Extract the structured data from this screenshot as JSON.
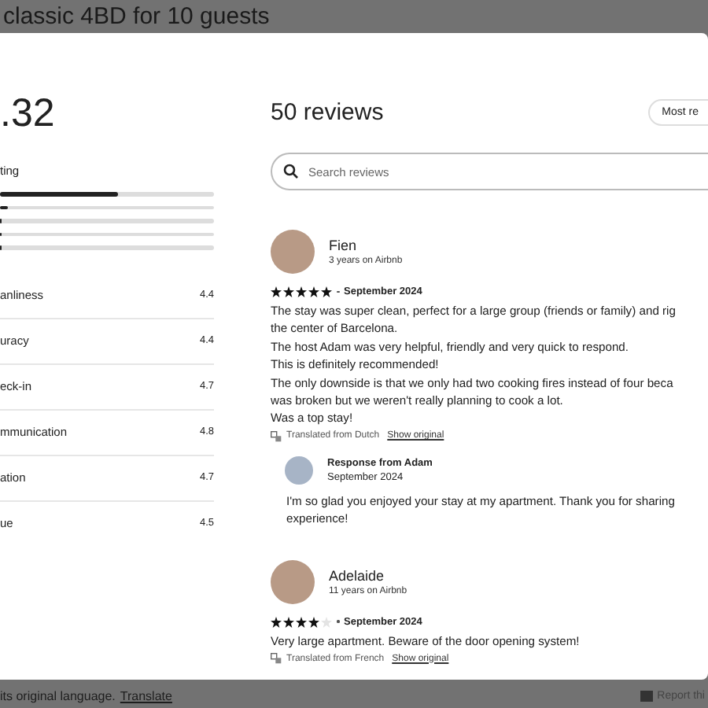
{
  "page_title": "classic 4BD for 10 guests",
  "rating": {
    "average": ".32",
    "label": "ting",
    "bars": [
      {
        "level": 0.55
      },
      {
        "level": 0.04
      },
      {
        "level": 0
      },
      {
        "level": 0
      },
      {
        "level": 0
      }
    ],
    "categories": [
      {
        "name": "anliness",
        "score": "4.4"
      },
      {
        "name": "uracy",
        "score": "4.4"
      },
      {
        "name": "eck-in",
        "score": "4.7"
      },
      {
        "name": "mmunication",
        "score": "4.8"
      },
      {
        "name": "ation",
        "score": "4.7"
      },
      {
        "name": "ue",
        "score": "4.5"
      }
    ]
  },
  "reviews_header": {
    "title": "50 reviews",
    "sort_button": "Most re"
  },
  "search": {
    "placeholder": "Search reviews"
  },
  "reviews": [
    {
      "name": "Fien",
      "tenure": "3 years on Airbnb",
      "stars": 5,
      "date": "September 2024",
      "lines": [
        "The stay was super clean, perfect for a large group (friends or family) and rig",
        "the center of Barcelona.",
        "The host Adam was very helpful, friendly and very quick to respond.",
        "This is definitely recommended!",
        "The only downside is that we only had two cooking fires instead of four beca",
        "was broken but we weren't really planning to cook a lot.",
        "Was a top stay!"
      ],
      "translation": {
        "note": "Translated from Dutch",
        "link": "Show original"
      },
      "response": {
        "title": "Response from Adam",
        "date": "September 2024",
        "lines": [
          "I'm so glad you enjoyed your stay at my apartment. Thank you for sharing",
          "experience!"
        ]
      }
    },
    {
      "name": "Adelaide",
      "tenure": "11 years on Airbnb",
      "stars": 4,
      "date": "September 2024",
      "lines": [
        "Very large apartment. Beware of the door opening system!"
      ],
      "translation": {
        "note": "Translated from French",
        "link": "Show original"
      }
    }
  ],
  "footer": {
    "text": "its original language.",
    "link": "Translate",
    "report": "Report thi"
  }
}
